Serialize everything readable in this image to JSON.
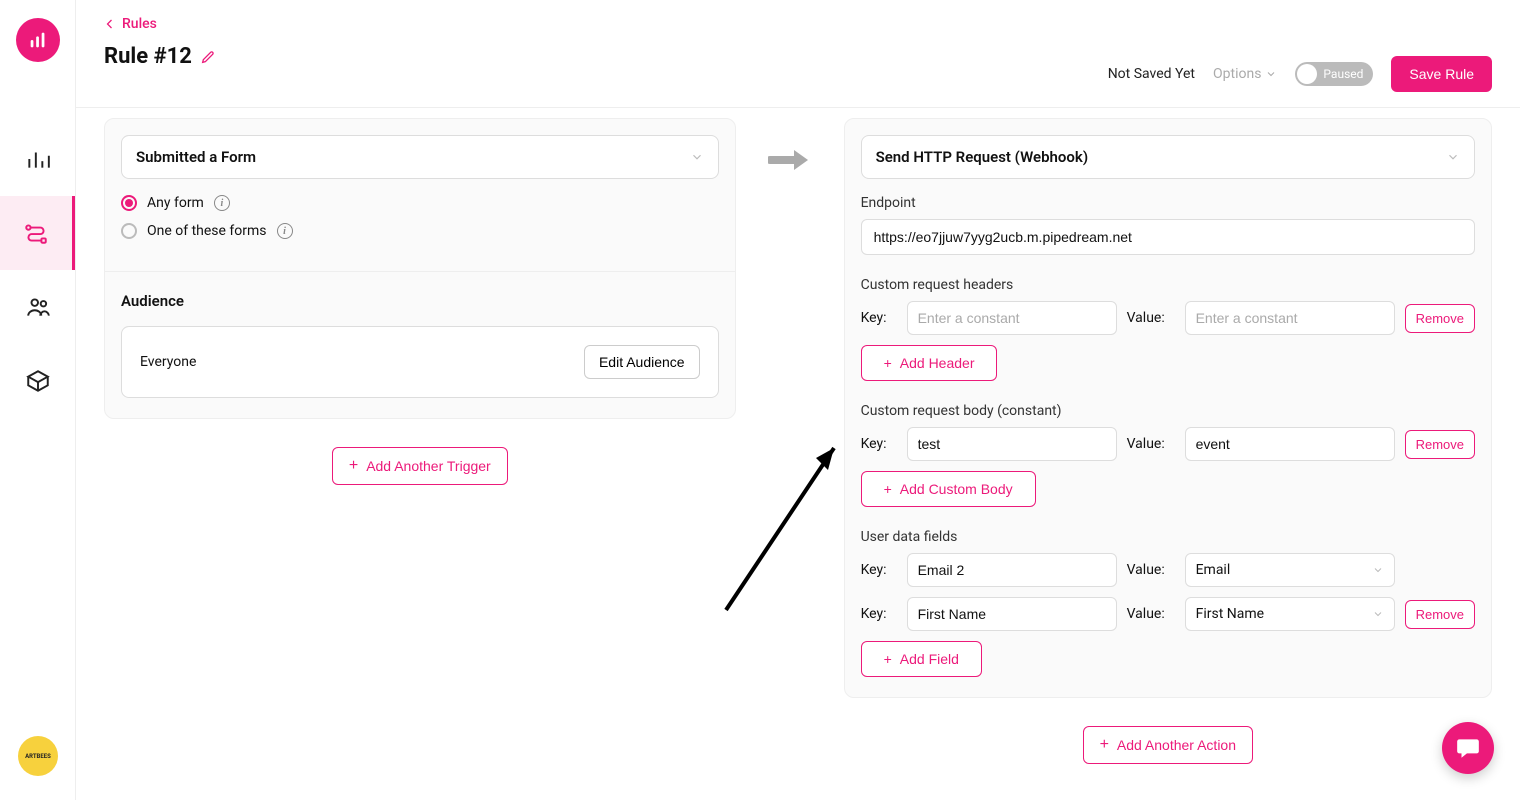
{
  "breadcrumb": {
    "label": "Rules"
  },
  "title": "Rule #12",
  "header": {
    "status": "Not Saved Yet",
    "options_label": "Options",
    "toggle_label": "Paused",
    "save_label": "Save Rule"
  },
  "trigger": {
    "selector_label": "Submitted a Form",
    "radios": {
      "any": "Any form",
      "one_of": "One of these forms"
    },
    "audience_title": "Audience",
    "audience_value": "Everyone",
    "edit_audience_label": "Edit Audience",
    "add_trigger_label": "Add Another Trigger"
  },
  "action": {
    "selector_label": "Send HTTP Request (Webhook)",
    "endpoint_label": "Endpoint",
    "endpoint_value": "https://eo7jjuw7yyg2ucb.m.pipedream.net",
    "headers_title": "Custom request headers",
    "body_title": "Custom request body (constant)",
    "fields_title": "User data fields",
    "key_label": "Key:",
    "value_label": "Value:",
    "placeholder_constant": "Enter a constant",
    "remove_label": "Remove",
    "add_header_label": "Add Header",
    "add_body_label": "Add Custom Body",
    "add_field_label": "Add Field",
    "body_rows": [
      {
        "key": "test",
        "value": "event"
      }
    ],
    "field_rows": [
      {
        "key": "Email 2",
        "value": "Email"
      },
      {
        "key": "First Name",
        "value": "First Name"
      }
    ],
    "add_action_label": "Add Another Action"
  },
  "badge_text": "ARTBEES"
}
